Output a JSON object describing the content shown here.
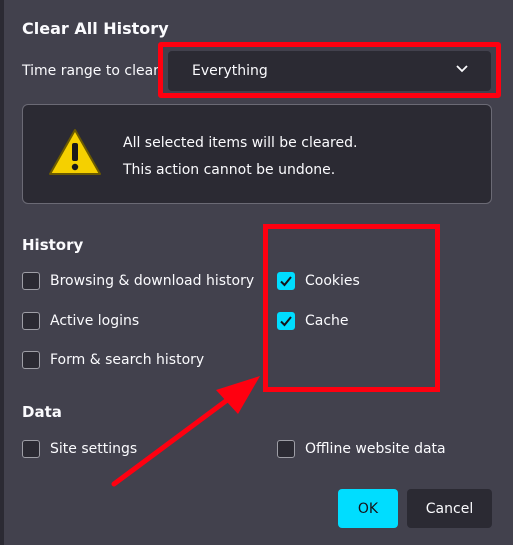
{
  "dialog": {
    "title": "Clear All History",
    "time_range_label": "Time range to clear:",
    "time_range_value": "Everything",
    "warning_line1": "All selected items will be cleared.",
    "warning_line2": "This action cannot be undone."
  },
  "history": {
    "heading": "History",
    "items": [
      {
        "label": "Browsing & download history",
        "checked": false
      },
      {
        "label": "Active logins",
        "checked": false
      },
      {
        "label": "Form & search history",
        "checked": false
      },
      {
        "label": "Cookies",
        "checked": true
      },
      {
        "label": "Cache",
        "checked": true
      }
    ]
  },
  "data": {
    "heading": "Data",
    "items": [
      {
        "label": "Site settings",
        "checked": false
      },
      {
        "label": "Offline website data",
        "checked": false
      }
    ]
  },
  "buttons": {
    "ok": "OK",
    "cancel": "Cancel"
  },
  "colors": {
    "background": "#42414d",
    "panel": "#2b2a33",
    "accent": "#00ddff",
    "highlight": "#ff0010"
  },
  "icons": {
    "warning": "warning-icon",
    "dropdown": "chevron-down-icon",
    "check": "check-icon"
  }
}
